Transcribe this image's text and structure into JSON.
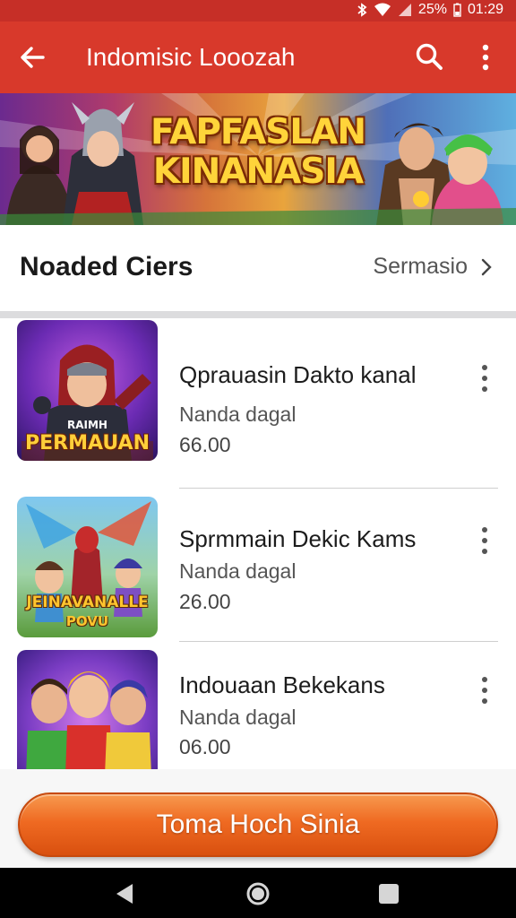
{
  "status": {
    "battery": "25%",
    "time": "01:29"
  },
  "appbar": {
    "title": "Indomisic Looozah"
  },
  "banner": {
    "title_line1": "FAPFASLAN",
    "title_line2": "KINANASIA"
  },
  "section": {
    "title": "Noaded Ciers",
    "link": "Sermasio"
  },
  "items": [
    {
      "name": "Qprauasin Dakto kanal",
      "sub": "Nanda dagal",
      "price": "66.00",
      "thumb_text": "PERMAUAN",
      "thumb_small": "RAIMH"
    },
    {
      "name": "Sprmmain Dekic Kams",
      "sub": "Nanda dagal",
      "price": "26.00",
      "thumb_text": "JEINAVANALLE",
      "thumb_small": "POVU"
    },
    {
      "name": "Indouaan Bekekans",
      "sub": "Nanda dagal",
      "price": "06.00"
    }
  ],
  "cta": {
    "label": "Toma Hoch Sinia"
  },
  "colors": {
    "appbar": "#d8392b",
    "statusbar": "#c62f27",
    "cta": "#ef6a22"
  }
}
